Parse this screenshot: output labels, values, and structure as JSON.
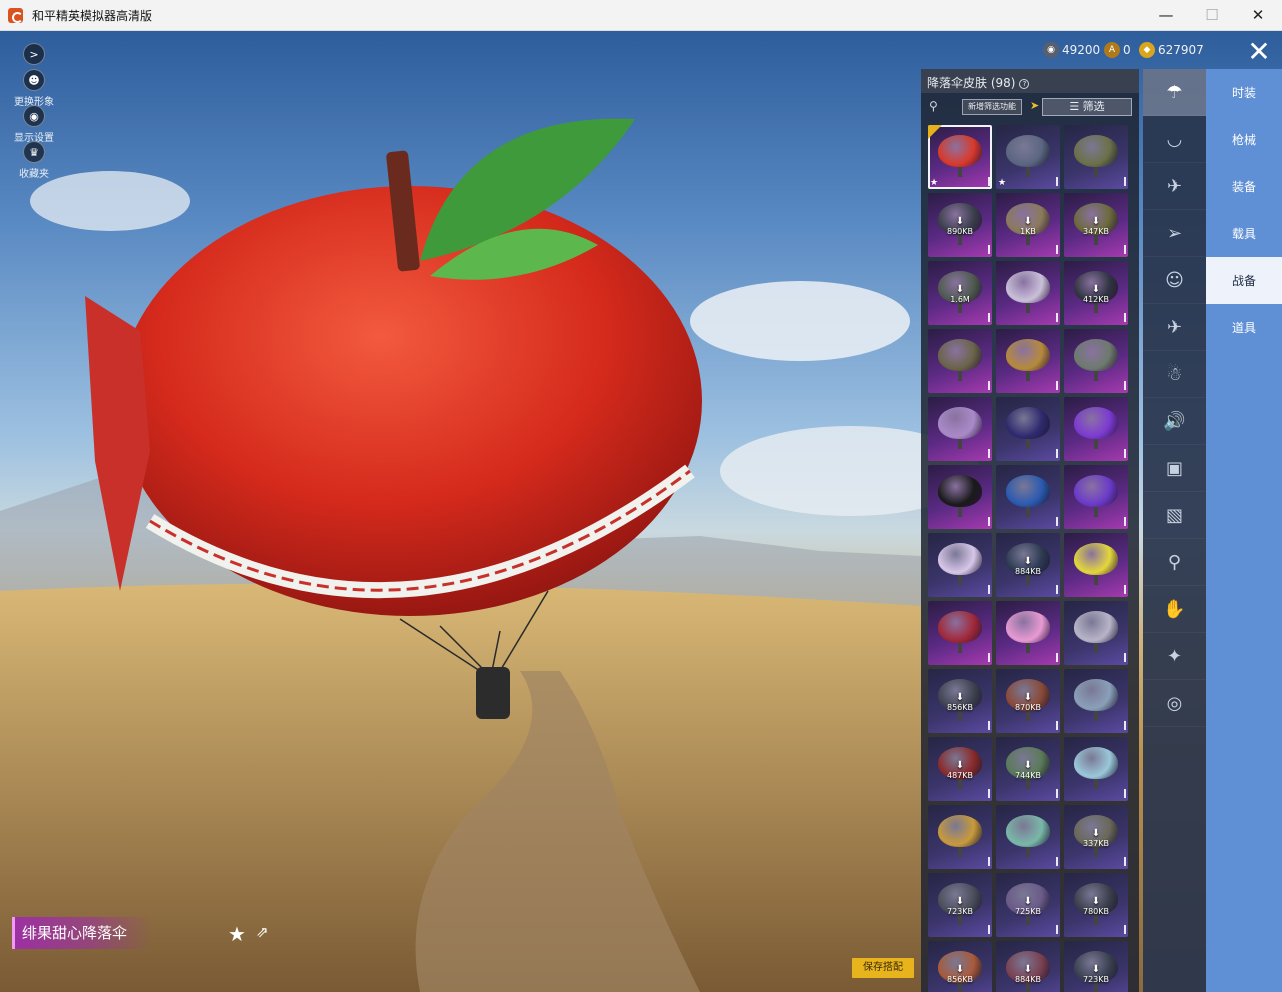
{
  "window": {
    "title": "和平精英模拟器高清版",
    "minimize": "—",
    "maximize": "☐",
    "close": "✕"
  },
  "left_controls": {
    "expand": ">",
    "change_appearance": "更换形象",
    "display_settings": "显示设置",
    "collection": "收藏夹"
  },
  "currency": {
    "silver": "49200",
    "coupon": "0",
    "gold": "627907"
  },
  "close_panel": "✕",
  "panel": {
    "title": "降落伞皮肤 (98)",
    "help": "?",
    "new_filter": "新增筛选功能",
    "filter_button": "筛选"
  },
  "grid": [
    {
      "rarity": "pink",
      "color": "#d8392a",
      "selected": true,
      "star": true
    },
    {
      "rarity": "purple",
      "color": "#5b6680",
      "star": true
    },
    {
      "rarity": "purple",
      "color": "#6b7048"
    },
    {
      "rarity": "pink",
      "color": "#3a3f4a",
      "size": "890KB"
    },
    {
      "rarity": "pink",
      "color": "#8a7a5a",
      "size": "1KB"
    },
    {
      "rarity": "pink",
      "color": "#6b6a3a",
      "size": "347KB"
    },
    {
      "rarity": "pink",
      "color": "#4e5a4e",
      "size": "1.6M"
    },
    {
      "rarity": "pink",
      "color": "#c9c0d8"
    },
    {
      "rarity": "pink",
      "color": "#2f3440",
      "size": "412KB"
    },
    {
      "rarity": "pink",
      "color": "#6a6448"
    },
    {
      "rarity": "pink",
      "color": "#b58a3a"
    },
    {
      "rarity": "pink",
      "color": "#6c7a6c"
    },
    {
      "rarity": "pink",
      "color": "#a98ac8"
    },
    {
      "rarity": "purple",
      "color": "#2f2a6e"
    },
    {
      "rarity": "pink",
      "color": "#7b3ad0"
    },
    {
      "rarity": "pink",
      "color": "#1a1a1a"
    },
    {
      "rarity": "purple",
      "color": "#2a5ab0"
    },
    {
      "rarity": "pink",
      "color": "#6a3ac8"
    },
    {
      "rarity": "purple",
      "color": "#d7c6e8"
    },
    {
      "rarity": "purple",
      "color": "#2d3a52",
      "size": "884KB"
    },
    {
      "rarity": "pink",
      "color": "#e3d73a"
    },
    {
      "rarity": "pink",
      "color": "#a02838"
    },
    {
      "rarity": "pink",
      "color": "#e79ad1"
    },
    {
      "rarity": "purple",
      "color": "#b8b4c8"
    },
    {
      "rarity": "purple",
      "color": "#3e4250",
      "size": "856KB"
    },
    {
      "rarity": "purple",
      "color": "#8a4a38",
      "size": "870KB"
    },
    {
      "rarity": "purple",
      "color": "#8aa0b8"
    },
    {
      "rarity": "purple",
      "color": "#8a2a2a",
      "size": "487KB"
    },
    {
      "rarity": "purple",
      "color": "#5a7a58",
      "size": "744KB"
    },
    {
      "rarity": "purple",
      "color": "#9ac8d8"
    },
    {
      "rarity": "purple",
      "color": "#c89a3a"
    },
    {
      "rarity": "purple",
      "color": "#7ab8a8"
    },
    {
      "rarity": "purple",
      "color": "#6a6858",
      "size": "337KB"
    },
    {
      "rarity": "purple",
      "color": "#4a4e5a",
      "size": "723KB"
    },
    {
      "rarity": "purple",
      "color": "#6a5a88",
      "size": "725KB"
    },
    {
      "rarity": "purple",
      "color": "#3a3e4a",
      "size": "780KB"
    },
    {
      "rarity": "purple",
      "color": "#a85a3a",
      "size": "856KB"
    },
    {
      "rarity": "purple",
      "color": "#7a4050",
      "size": "884KB"
    },
    {
      "rarity": "purple",
      "color": "#3a4050",
      "size": "723KB"
    }
  ],
  "icon_tabs": [
    {
      "name": "parachute-icon",
      "glyph": "☂",
      "active": true
    },
    {
      "name": "glider-icon",
      "glyph": "◡"
    },
    {
      "name": "plane-icon",
      "glyph": "✈"
    },
    {
      "name": "jet-icon",
      "glyph": "➢"
    },
    {
      "name": "emote-icon",
      "glyph": "☺"
    },
    {
      "name": "aircraft-icon",
      "glyph": "✈"
    },
    {
      "name": "pet-icon",
      "glyph": "☃"
    },
    {
      "name": "voice-icon",
      "glyph": "🔊"
    },
    {
      "name": "backpack-icon",
      "glyph": "▣"
    },
    {
      "name": "photo-icon",
      "glyph": "▧"
    },
    {
      "name": "extinguisher-icon",
      "glyph": "⚲"
    },
    {
      "name": "hand-icon",
      "glyph": "✋"
    },
    {
      "name": "wand-icon",
      "glyph": "✦"
    },
    {
      "name": "planet-icon",
      "glyph": "◎"
    }
  ],
  "categories": [
    {
      "label": "时装",
      "active": false
    },
    {
      "label": "枪械",
      "active": false
    },
    {
      "label": "装备",
      "active": false
    },
    {
      "label": "载具",
      "active": false
    },
    {
      "label": "战备",
      "active": true
    },
    {
      "label": "道具",
      "active": false
    }
  ],
  "item": {
    "name": "绯果甜心降落伞",
    "favorite": "★",
    "share": "⇗"
  },
  "save_button": "保存搭配",
  "colors": {
    "accent_pink": "#a73ab0",
    "category_blue": "#5f8fd4",
    "save_yellow": "#e7b41d"
  }
}
